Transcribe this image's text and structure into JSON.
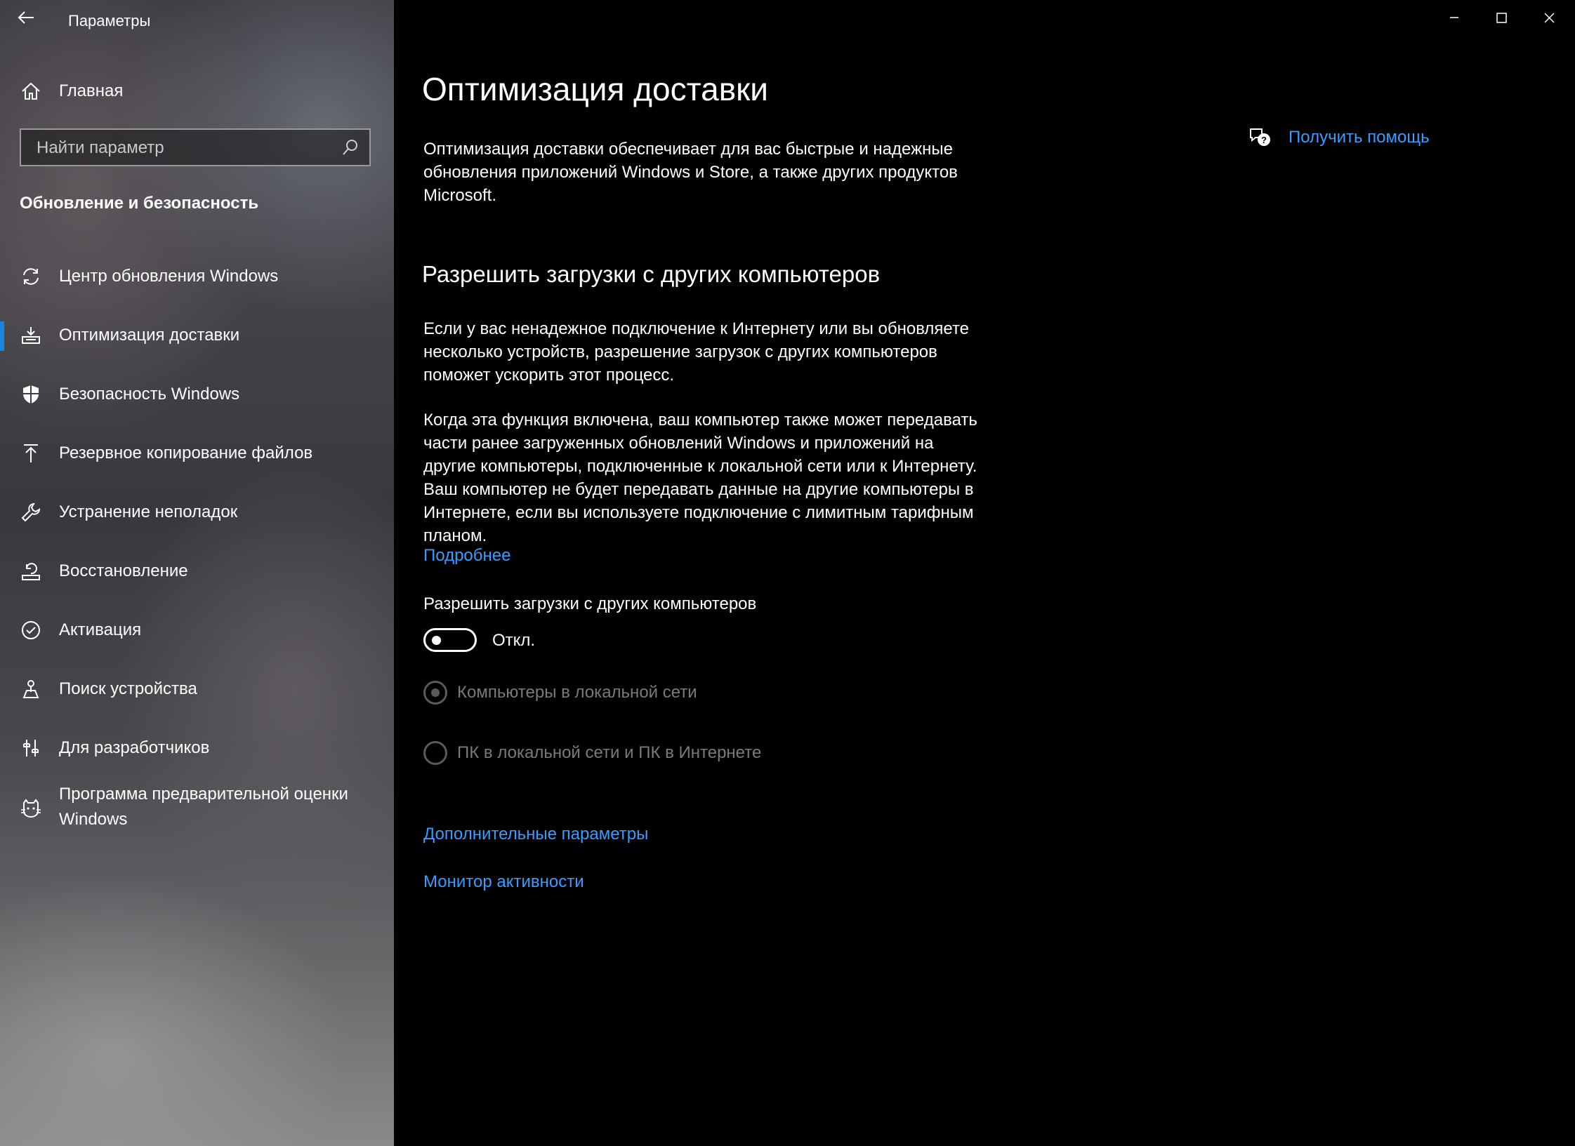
{
  "window": {
    "app_title": "Параметры"
  },
  "sidebar": {
    "home_label": "Главная",
    "search_placeholder": "Найти параметр",
    "section_title": "Обновление и безопасность",
    "items": [
      {
        "label": "Центр обновления Windows",
        "icon": "sync-icon"
      },
      {
        "label": "Оптимизация доставки",
        "icon": "delivery-optimization-icon",
        "active": true
      },
      {
        "label": "Безопасность Windows",
        "icon": "shield-icon"
      },
      {
        "label": "Резервное копирование файлов",
        "icon": "backup-arrow-up-icon"
      },
      {
        "label": "Устранение неполадок",
        "icon": "wrench-icon"
      },
      {
        "label": "Восстановление",
        "icon": "recovery-icon"
      },
      {
        "label": "Активация",
        "icon": "check-circle-icon"
      },
      {
        "label": "Поиск устройства",
        "icon": "find-device-icon"
      },
      {
        "label": "Для разработчиков",
        "icon": "developer-tools-icon"
      },
      {
        "label_line1": "Программа предварительной оценки",
        "label_line2": "Windows",
        "icon": "insider-cat-icon"
      }
    ]
  },
  "main": {
    "title": "Оптимизация доставки",
    "intro": "Оптимизация доставки обеспечивает для вас быстрые и надежные обновления приложений Windows и Store, а также других продуктов Microsoft.",
    "help_link": "Получить помощь",
    "section_heading": "Разрешить загрузки с других компьютеров",
    "para1": "Если у вас ненадежное подключение к Интернету или вы обновляете несколько устройств, разрешение загрузок с других компьютеров поможет ускорить этот процесс.",
    "para2": "Когда эта функция включена, ваш компьютер также может передавать части ранее загруженных обновлений Windows и приложений на другие компьютеры, подключенные к локальной сети или к Интернету. Ваш компьютер не будет передавать данные на другие компьютеры в Интернете, если вы используете подключение с лимитным тарифным планом.",
    "learn_more": "Подробнее",
    "toggle_label": "Разрешить загрузки с других компьютеров",
    "toggle_state": "Откл.",
    "radio_options": [
      {
        "label": "Компьютеры в локальной сети",
        "selected": true
      },
      {
        "label": "ПК в локальной сети и ПК в Интернете",
        "selected": false
      }
    ],
    "advanced_link": "Дополнительные параметры",
    "monitor_link": "Монитор активности"
  },
  "colors": {
    "accent": "#1a84e0",
    "link": "#3b9cff",
    "disabled": "#7a7a7a"
  }
}
